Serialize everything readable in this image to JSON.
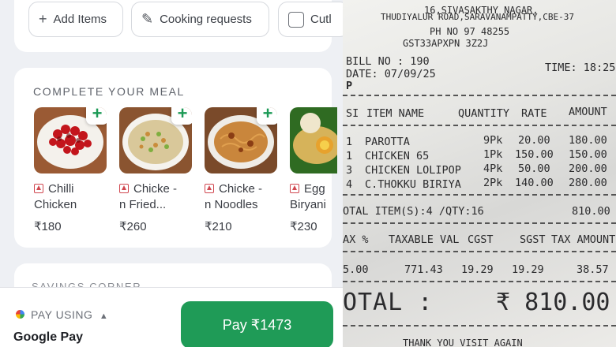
{
  "actions": {
    "add_items": "Add Items",
    "cooking_requests": "Cooking requests",
    "cutlery": "Cutl"
  },
  "meal": {
    "title": "COMPLETE YOUR MEAL",
    "items": [
      {
        "name": "Chilli\nChicken",
        "price": "₹180"
      },
      {
        "name": "Chicke -\nn Fried...",
        "price": "₹260"
      },
      {
        "name": "Chicke -\nn Noodles",
        "price": "₹210"
      },
      {
        "name": "Egg\nBiryani",
        "price": "₹230"
      }
    ]
  },
  "savings": {
    "title": "SAVINGS CORNER"
  },
  "payment": {
    "pay_using": "PAY USING",
    "method": "Google Pay",
    "button": "Pay ₹1473"
  },
  "receipt": {
    "address1": "16,SIVASAKTHY NAGAR,",
    "address2": "THUDIYALUR ROAD,SARAVANAMPATTY,CBE-37",
    "phone": "PH NO 97  48255",
    "gst": "GST33APXPN  3Z2J",
    "bill_no": "BILL NO : 190",
    "date": "DATE: 07/09/25",
    "time": "TIME: 18:25",
    "type": "P",
    "headers": [
      "SI",
      "ITEM NAME",
      "QUANTITY",
      "RATE",
      "AMOUNT"
    ],
    "rows": [
      {
        "si": "1",
        "item": "PAROTTA",
        "qty": "9Pk",
        "rate": "20.00",
        "amount": "180.00"
      },
      {
        "si": "1",
        "item": "CHICKEN 65",
        "qty": "1Pk",
        "rate": "150.00",
        "amount": "150.00"
      },
      {
        "si": "3",
        "item": "CHICKEN LOLIPOP",
        "qty": "4Pk",
        "rate": "50.00",
        "amount": "200.00"
      },
      {
        "si": "4",
        "item": "C.THOKKU BIRIYA",
        "qty": "2Pk",
        "rate": "140.00",
        "amount": "280.00"
      }
    ],
    "total_items": "OTAL ITEM(S):4 /QTY:16",
    "total_items_amount": "810.00",
    "tax_headers": [
      "AX %",
      "TAXABLE VAL",
      "CGST",
      "SGST",
      "TAX AMOUNT"
    ],
    "tax_row": [
      "5.00",
      "771.43",
      "19.29",
      "19.29",
      "38.57"
    ],
    "total_label": "OTAL :",
    "total_value": "₹ 810.00",
    "footer": "THANK YOU VISIT AGAIN"
  }
}
